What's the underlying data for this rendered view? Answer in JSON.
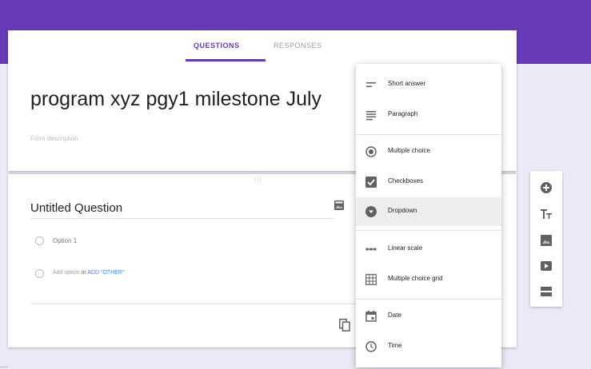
{
  "tabs": {
    "questions": "QUESTIONS",
    "responses": "RESPONSES"
  },
  "form": {
    "title": "program xyz pgy1 milestone July",
    "description_placeholder": "Form description"
  },
  "question": {
    "drag_handle": "⁞⁞⁞",
    "title": "Untitled Question",
    "option1": "Option 1",
    "add_option": "Add option",
    "or": "or",
    "add_other": "ADD \"OTHER\""
  },
  "menu": {
    "items": [
      {
        "label": "Short answer",
        "icon": "short-answer-icon"
      },
      {
        "label": "Paragraph",
        "icon": "paragraph-icon"
      },
      {
        "label": "Multiple choice",
        "icon": "radio-button-icon"
      },
      {
        "label": "Checkboxes",
        "icon": "checkbox-icon"
      },
      {
        "label": "Dropdown",
        "icon": "dropdown-icon",
        "selected": true
      },
      {
        "label": "Linear scale",
        "icon": "linear-scale-icon"
      },
      {
        "label": "Multiple choice grid",
        "icon": "grid-icon"
      },
      {
        "label": "Date",
        "icon": "calendar-icon"
      },
      {
        "label": "Time",
        "icon": "clock-icon"
      }
    ]
  },
  "toolbar": {
    "tools": [
      "add-question-icon",
      "title-text-icon",
      "image-icon",
      "video-icon",
      "section-icon"
    ]
  },
  "colors": {
    "primary": "#673ab7",
    "background": "#ede8f6",
    "link": "#4285f4"
  }
}
